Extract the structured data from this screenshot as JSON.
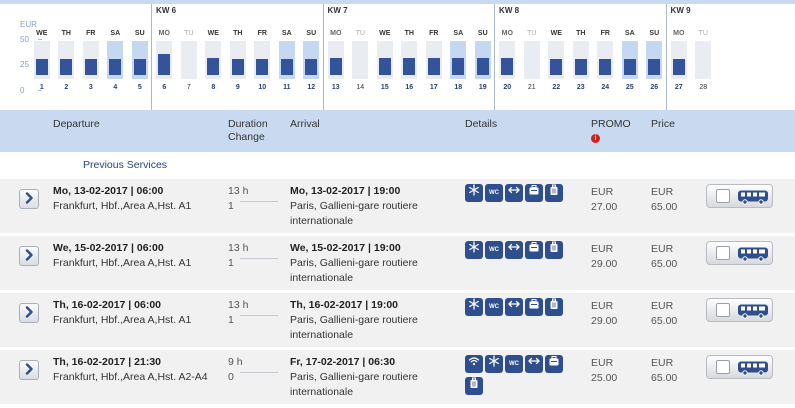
{
  "calendar": {
    "y_axis": {
      "currency": "EUR",
      "ticks": [
        "50",
        "25",
        "0"
      ]
    },
    "weeks": [
      {
        "label": "KW 6",
        "start": 5
      },
      {
        "label": "KW 7",
        "start": 12
      },
      {
        "label": "KW 8",
        "start": 19
      },
      {
        "label": "KW 9",
        "start": 26
      }
    ],
    "days": [
      {
        "name": "WE",
        "num": "1",
        "value": 25,
        "type": "n"
      },
      {
        "name": "TH",
        "num": "2",
        "value": 25,
        "type": "n"
      },
      {
        "name": "FR",
        "num": "3",
        "value": 25,
        "type": "n"
      },
      {
        "name": "SA",
        "num": "4",
        "value": 25,
        "type": "w"
      },
      {
        "name": "SU",
        "num": "5",
        "value": 25,
        "type": "w"
      },
      {
        "name": "MO",
        "num": "6",
        "value": 33,
        "type": "m"
      },
      {
        "name": "TU",
        "num": "7",
        "value": null,
        "type": "o"
      },
      {
        "name": "WE",
        "num": "8",
        "value": 27,
        "type": "n"
      },
      {
        "name": "TH",
        "num": "9",
        "value": 25,
        "type": "n"
      },
      {
        "name": "FR",
        "num": "10",
        "value": 25,
        "type": "n"
      },
      {
        "name": "SA",
        "num": "11",
        "value": 25,
        "type": "w"
      },
      {
        "name": "SU",
        "num": "12",
        "value": 25,
        "type": "w"
      },
      {
        "name": "MO",
        "num": "13",
        "value": 27,
        "type": "m"
      },
      {
        "name": "TU",
        "num": "14",
        "value": null,
        "type": "o"
      },
      {
        "name": "WE",
        "num": "15",
        "value": 27,
        "type": "n"
      },
      {
        "name": "TH",
        "num": "16",
        "value": 27,
        "type": "n"
      },
      {
        "name": "FR",
        "num": "17",
        "value": 27,
        "type": "n"
      },
      {
        "name": "SA",
        "num": "18",
        "value": 27,
        "type": "w"
      },
      {
        "name": "SU",
        "num": "19",
        "value": 27,
        "type": "w"
      },
      {
        "name": "MO",
        "num": "20",
        "value": 27,
        "type": "m"
      },
      {
        "name": "TU",
        "num": "21",
        "value": null,
        "type": "o"
      },
      {
        "name": "WE",
        "num": "22",
        "value": 25,
        "type": "n"
      },
      {
        "name": "TH",
        "num": "23",
        "value": 25,
        "type": "n"
      },
      {
        "name": "FR",
        "num": "24",
        "value": 25,
        "type": "n"
      },
      {
        "name": "SA",
        "num": "25",
        "value": 25,
        "type": "w"
      },
      {
        "name": "SU",
        "num": "26",
        "value": 25,
        "type": "w"
      },
      {
        "name": "MO",
        "num": "27",
        "value": 25,
        "type": "m"
      },
      {
        "name": "TU",
        "num": "28",
        "value": null,
        "type": "o"
      }
    ]
  },
  "table_header": {
    "departure": "Departure",
    "duration": "Duration",
    "change": "Change",
    "arrival": "Arrival",
    "details": "Details",
    "promo": "PROMO",
    "promo_info": "i",
    "price": "Price"
  },
  "previous_services": "Previous Services",
  "rows": [
    {
      "dep_time": "Mo, 13-02-2017 | 06:00",
      "dep_place": "Frankfurt, Hbf.,Area A,Hst. A1",
      "duration": "13 h",
      "changes": "1",
      "arr_time": "Mo, 13-02-2017 | 19:00",
      "arr_place": "Paris, Gallieni-gare routiere internationale",
      "icons": [
        "snowflake-icon",
        "wc-icon",
        "legroom-icon",
        "luggage-icon",
        "suitcase-icon"
      ],
      "promo_cur": "EUR",
      "promo_val": "27.00",
      "price_cur": "EUR",
      "price_val": "65.00"
    },
    {
      "dep_time": "We, 15-02-2017 | 06:00",
      "dep_place": "Frankfurt, Hbf.,Area A,Hst. A1",
      "duration": "13 h",
      "changes": "1",
      "arr_time": "We, 15-02-2017 | 19:00",
      "arr_place": "Paris, Gallieni-gare routiere internationale",
      "icons": [
        "snowflake-icon",
        "wc-icon",
        "legroom-icon",
        "luggage-icon",
        "suitcase-icon"
      ],
      "promo_cur": "EUR",
      "promo_val": "29.00",
      "price_cur": "EUR",
      "price_val": "65.00"
    },
    {
      "dep_time": "Th, 16-02-2017 | 06:00",
      "dep_place": "Frankfurt, Hbf.,Area A,Hst. A1",
      "duration": "13 h",
      "changes": "1",
      "arr_time": "Th, 16-02-2017 | 19:00",
      "arr_place": "Paris, Gallieni-gare routiere internationale",
      "icons": [
        "snowflake-icon",
        "wc-icon",
        "legroom-icon",
        "luggage-icon",
        "suitcase-icon"
      ],
      "promo_cur": "EUR",
      "promo_val": "29.00",
      "price_cur": "EUR",
      "price_val": "65.00"
    },
    {
      "dep_time": "Th, 16-02-2017 | 21:30",
      "dep_place": "Frankfurt, Hbf.,Area A,Hst. A2-A4",
      "duration": "9 h",
      "changes": "0",
      "arr_time": "Fr, 17-02-2017 | 06:30",
      "arr_place": "Paris, Gallieni-gare routiere internationale",
      "icons": [
        "wifi-icon",
        "snowflake-icon",
        "wc-icon",
        "legroom-icon",
        "luggage-icon",
        "suitcase-icon"
      ],
      "promo_cur": "EUR",
      "promo_val": "25.00",
      "price_cur": "EUR",
      "price_val": "65.00"
    }
  ]
}
